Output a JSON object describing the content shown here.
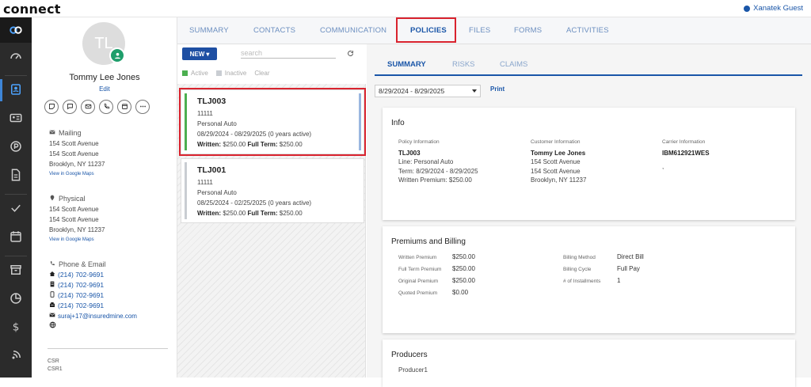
{
  "app": {
    "logo": "connect",
    "user": "Xanatek Guest"
  },
  "colors": {
    "brand_blue": "#1a56a8",
    "highlight_red": "#d9232e",
    "active_green": "#4caf50",
    "inactive_grey": "#c9cdd2",
    "nav_dark": "#2b2b2b"
  },
  "nav": {
    "icons": [
      "connect-logo-icon",
      "dashboard-icon",
      "contact-card-icon",
      "id-card-icon",
      "parking-p-icon",
      "document-icon",
      "check-icon",
      "calendar-icon",
      "archive-icon",
      "pie-chart-icon",
      "dollar-icon",
      "broadcast-icon"
    ]
  },
  "profile": {
    "initials": "TL",
    "name": "Tommy Lee Jones",
    "edit": "Edit",
    "mailing": {
      "label": "Mailing",
      "lines": [
        "154 Scott Avenue",
        "154 Scott Avenue",
        "Brooklyn, NY 11237"
      ],
      "map_link": "View in Google Maps"
    },
    "physical": {
      "label": "Physical",
      "lines": [
        "154 Scott Avenue",
        "154 Scott Avenue",
        "Brooklyn, NY 11237"
      ],
      "map_link": "View in Google Maps"
    },
    "phone_email": {
      "label": "Phone & Email",
      "phones": [
        "(214) 702-9691",
        "(214) 702-9691",
        "(214) 702-9691",
        "(214) 702-9691"
      ],
      "email": "suraj+17@insuredmine.com"
    },
    "csr": [
      "CSR",
      "CSR1"
    ]
  },
  "tabs": [
    "SUMMARY",
    "CONTACTS",
    "COMMUNICATION",
    "POLICIES",
    "FILES",
    "FORMS",
    "ACTIVITIES"
  ],
  "list": {
    "new_label": "NEW",
    "search_placeholder": "search",
    "legend": {
      "active": "Active",
      "inactive": "Inactive",
      "clear": "Clear"
    },
    "policies": [
      {
        "id": "TLJ003",
        "code": "11111",
        "line": "Personal Auto",
        "term": "08/29/2024 - 08/29/2025 (0 years active)",
        "written_label": "Written:",
        "written": "$250.00",
        "full_label": "Full Term:",
        "full": "$250.00"
      },
      {
        "id": "TLJ001",
        "code": "11111",
        "line": "Personal Auto",
        "term": "08/25/2024 - 02/25/2025 (0 years active)",
        "written_label": "Written:",
        "written": "$250.00",
        "full_label": "Full Term:",
        "full": "$250.00"
      }
    ]
  },
  "detail": {
    "subtabs": [
      "SUMMARY",
      "RISKS",
      "CLAIMS"
    ],
    "date_range": "8/29/2024 - 8/29/2025",
    "print": "Print",
    "info": {
      "title": "Info",
      "policy": {
        "label": "Policy Information",
        "id": "TLJ003",
        "line": "Line: Personal Auto",
        "term": "Term: 8/29/2024 - 8/29/2025",
        "premium": "Written Premium: $250.00"
      },
      "customer": {
        "label": "Customer Information",
        "name": "Tommy Lee Jones",
        "addr1": "154 Scott Avenue",
        "addr2": "154 Scott Avenue",
        "city": "Brooklyn, NY 11237"
      },
      "carrier": {
        "label": "Carrier Information",
        "id": "IBM612921WES",
        "extra": ","
      }
    },
    "premiums": {
      "title": "Premiums and Billing",
      "left": [
        {
          "k": "Written Premium",
          "v": "$250.00"
        },
        {
          "k": "Full Term Premium",
          "v": "$250.00"
        },
        {
          "k": "Original Premium",
          "v": "$250.00"
        },
        {
          "k": "Quoted Premium",
          "v": "$0.00"
        }
      ],
      "right": [
        {
          "k": "Billing Method",
          "v": "Direct Bill"
        },
        {
          "k": "Billing Cycle",
          "v": "Full Pay"
        },
        {
          "k": "# of Installments",
          "v": "1"
        }
      ]
    },
    "producers": {
      "title": "Producers",
      "items": [
        "Producer1"
      ]
    }
  }
}
